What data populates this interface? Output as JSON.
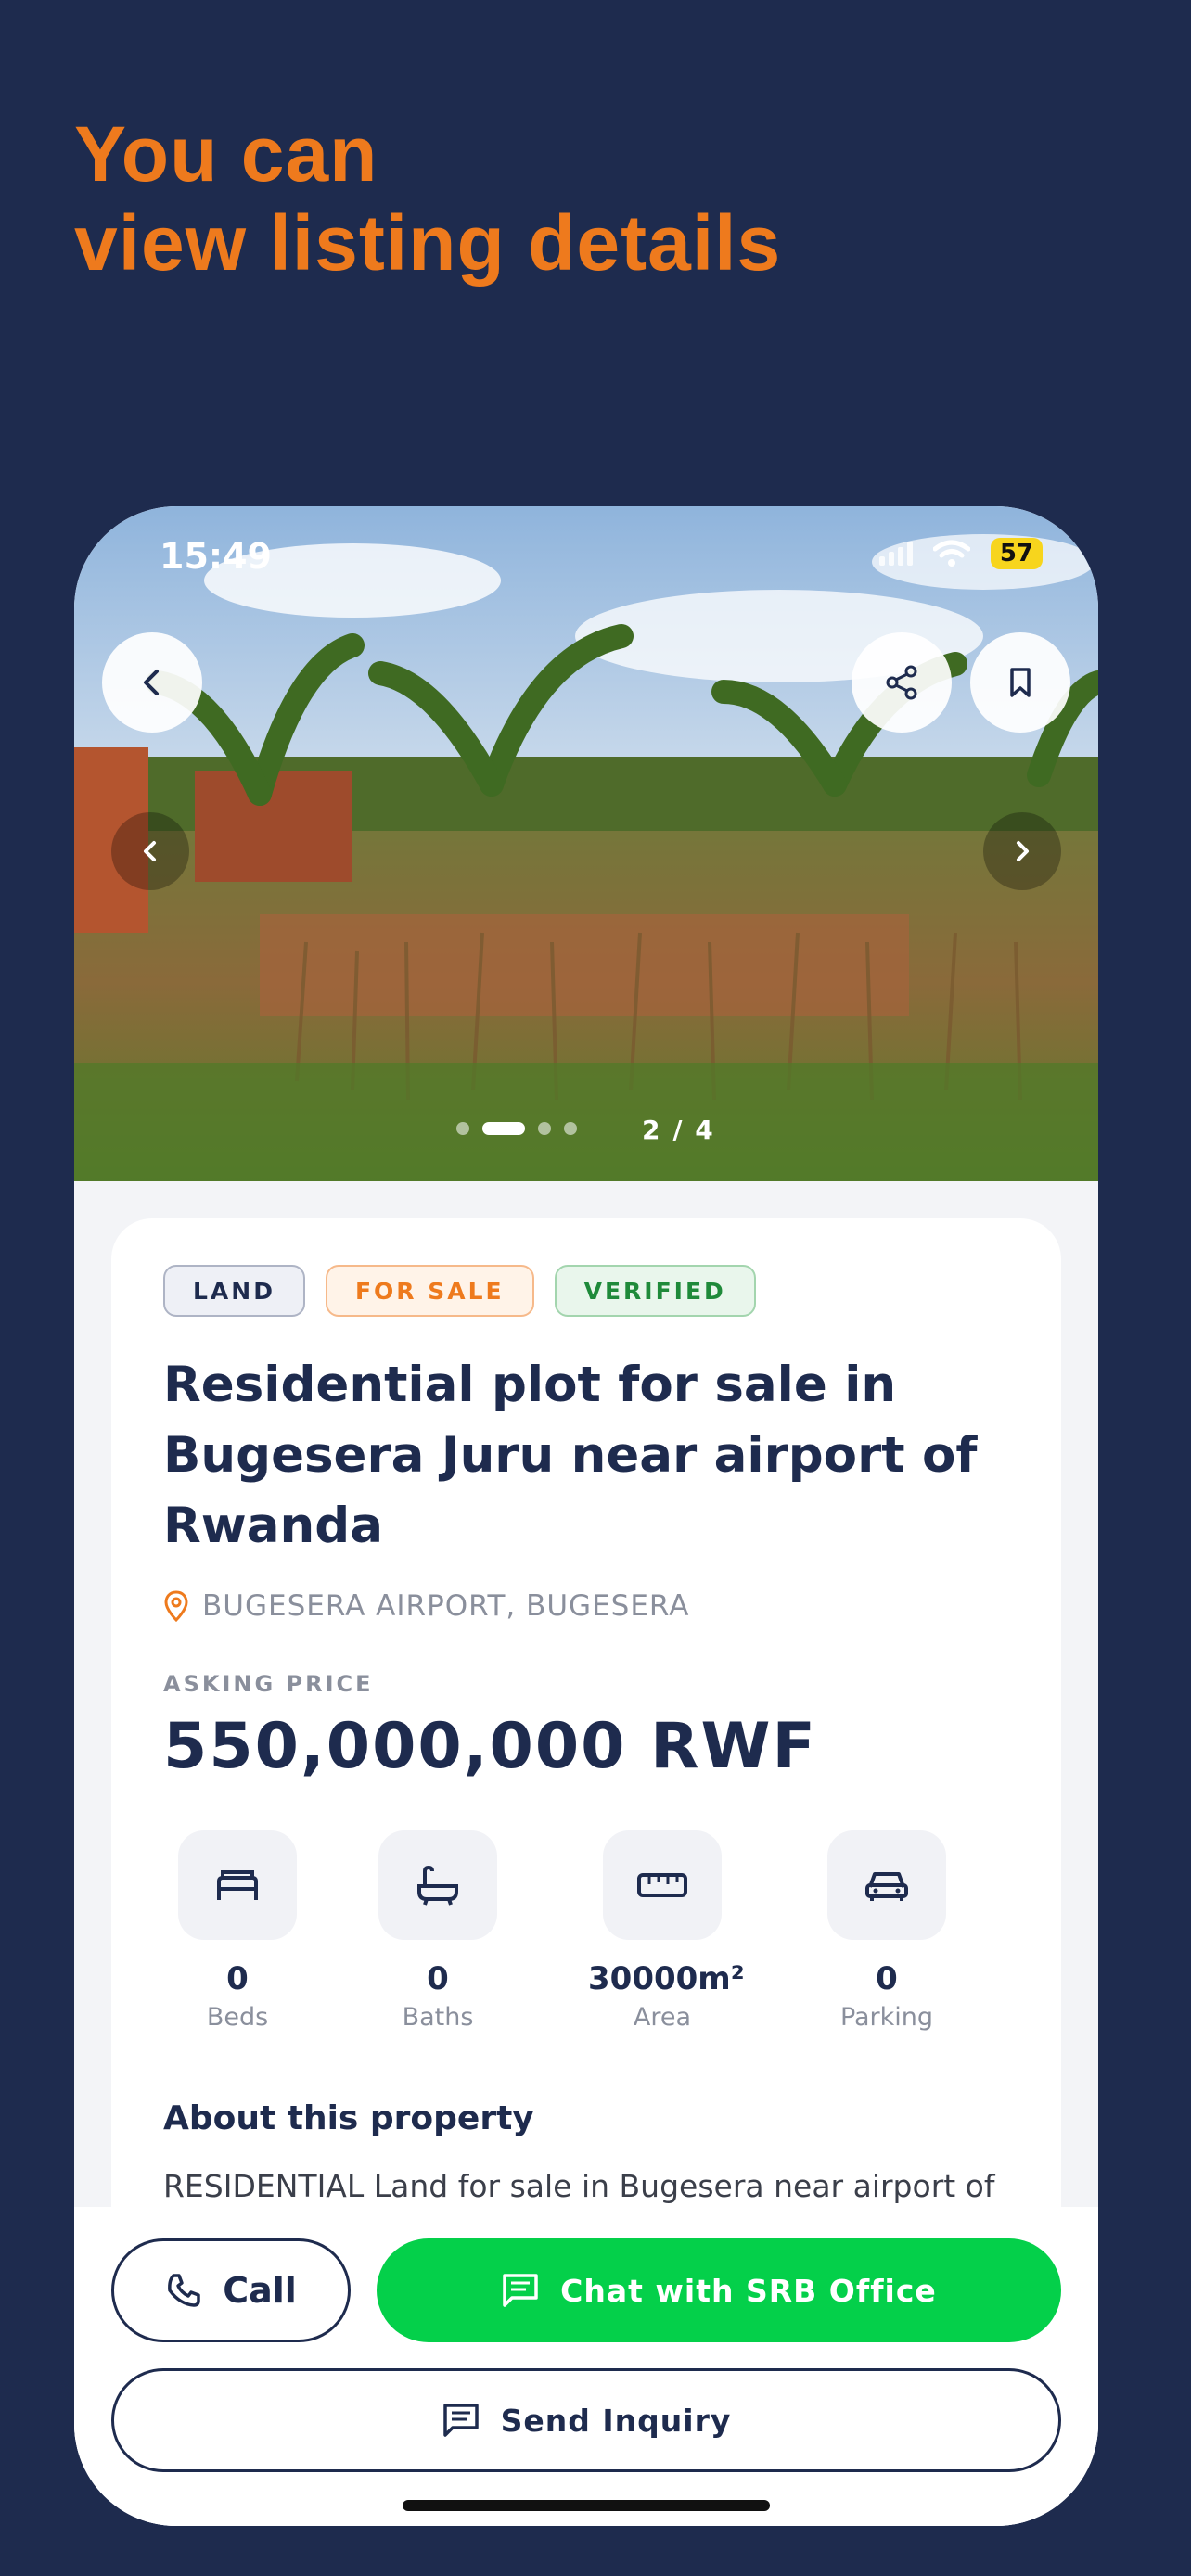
{
  "headline": {
    "line1": "You can",
    "line2": "view listing details"
  },
  "status_bar": {
    "time": "15:49",
    "battery": "57"
  },
  "gallery": {
    "counter": "2 / 4",
    "current_index": 2,
    "total": 4
  },
  "tags": {
    "type": "LAND",
    "status": "FOR SALE",
    "verification": "VERIFIED"
  },
  "listing": {
    "title": "Residential plot for sale in Bugesera Juru near airport of Rwanda",
    "location": "BUGESERA AIRPORT, BUGESERA",
    "price_label": "ASKING PRICE",
    "price": "550,000,000 RWF"
  },
  "stats": {
    "beds": {
      "value": "0",
      "label": "Beds",
      "icon": "bed-icon"
    },
    "baths": {
      "value": "0",
      "label": "Baths",
      "icon": "bathtub-icon"
    },
    "area": {
      "value": "30000m²",
      "label": "Area",
      "icon": "ruler-icon"
    },
    "parking": {
      "value": "0",
      "label": "Parking",
      "icon": "car-icon"
    }
  },
  "about": {
    "title": "About this property",
    "text": "RESIDENTIAL Land for sale in Bugesera near airport of Rwanda Hot deal"
  },
  "actions": {
    "call": "Call",
    "chat": "Chat with SRB Office",
    "inquiry": "Send Inquiry"
  },
  "colors": {
    "background": "#1e2b4e",
    "accent": "#ee7a1d",
    "chat_green": "#04d04a",
    "verified_green": "#1f8a3a"
  }
}
